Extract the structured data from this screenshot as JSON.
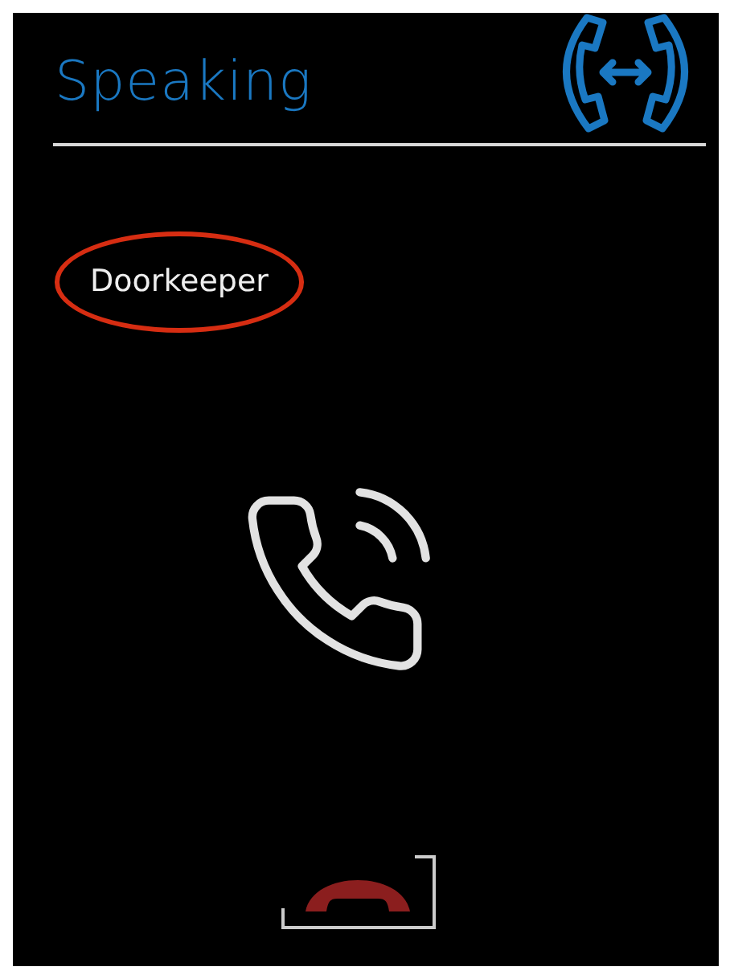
{
  "title": "Speaking",
  "caller": {
    "name": "Doorkeeper",
    "highlighted": true
  },
  "hangup": {
    "focused": true
  }
}
